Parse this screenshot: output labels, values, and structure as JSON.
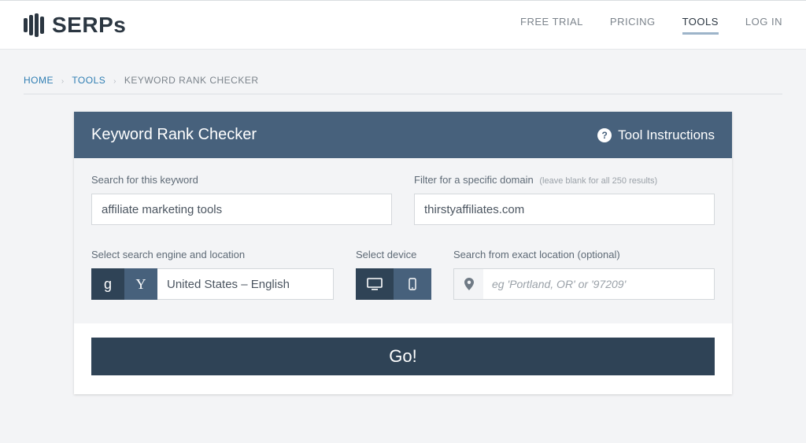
{
  "brand": {
    "name": "SERPs"
  },
  "nav": {
    "free_trial": "FREE TRIAL",
    "pricing": "PRICING",
    "tools": "TOOLS",
    "login": "LOG IN"
  },
  "breadcrumb": {
    "home": "HOME",
    "tools": "TOOLS",
    "current": "KEYWORD RANK CHECKER"
  },
  "card": {
    "title": "Keyword Rank Checker",
    "instructions": "Tool Instructions"
  },
  "form": {
    "keyword_label": "Search for this keyword",
    "keyword_value": "affiliate marketing tools",
    "domain_label": "Filter for a specific domain",
    "domain_hint": "(leave blank for all 250 results)",
    "domain_value": "thirstyaffiliates.com",
    "engine_label": "Select search engine and location",
    "engine_google": "g",
    "engine_yahoo": "Y",
    "location_value": "United States – English",
    "device_label": "Select device",
    "exact_label": "Search from exact location (optional)",
    "exact_placeholder": "eg 'Portland, OR' or '97209'",
    "go": "Go!"
  }
}
